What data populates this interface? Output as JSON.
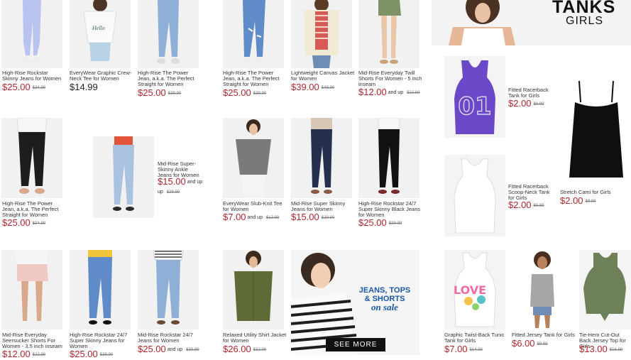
{
  "products": [
    {
      "id": "p1",
      "name": "High-Rise Rockstar Skinny Jeans for Women",
      "price": "$25.00",
      "old": "$34.99",
      "andup": ""
    },
    {
      "id": "p2",
      "name": "EveryWear Graphic Crew-Neck Tee for Women",
      "price": "$14.99",
      "old": "",
      "andup": ""
    },
    {
      "id": "p3",
      "name": "High-Rise The Power Jean, a.k.a. The Perfect Straight for Women",
      "price": "$25.00",
      "old": "$39.99",
      "andup": ""
    },
    {
      "id": "p4",
      "name": "High-Rise The Power Jean, a.k.a. The Perfect Straight for Women",
      "price": "$25.00",
      "old": "$39.99",
      "andup": ""
    },
    {
      "id": "p5",
      "name": "Lightweight Canvas Jacket for Women",
      "price": "$39.00",
      "old": "$49.99",
      "andup": ""
    },
    {
      "id": "p6",
      "name": "Mid-Rise Everyday Twill Shorts For Women - 5 inch inseam",
      "price": "$12.00",
      "old": "$22.99",
      "andup": "and up"
    },
    {
      "id": "p7",
      "name": "High-Rise The Power Jean, a.k.a. The Perfect Straight for Women",
      "price": "$25.00",
      "old": "$34.99",
      "andup": ""
    },
    {
      "id": "p8",
      "name": "Mid-Rise Super-Skinny Ankle Jeans for Women",
      "price": "$15.00",
      "old": "$29.99",
      "andup": "and up"
    },
    {
      "id": "p9",
      "name": "EveryWear Slub-Knit Tee for Women",
      "price": "$7.00",
      "old": "$12.99",
      "andup": "and up"
    },
    {
      "id": "p10",
      "name": "Mid-Rise Super Skinny Jeans for Women",
      "price": "$15.00",
      "old": "$29.99",
      "andup": ""
    },
    {
      "id": "p11",
      "name": "High-Rise Rockstar 24/7 Super Skinny Black Jeans for Women",
      "price": "$25.00",
      "old": "$39.99",
      "andup": ""
    },
    {
      "id": "p12",
      "name": "Mid-Rise Everyday Seersucker Shorts For Women - 3.5 inch inseam",
      "price": "$12.00",
      "old": "$22.99",
      "andup": ""
    },
    {
      "id": "p13",
      "name": "High-Rise Rockstar 24/7 Super Skinny Jeans for Women",
      "price": "$25.00",
      "old": "$39.99",
      "andup": ""
    },
    {
      "id": "p14",
      "name": "Mid-Rise Rockstar 24/7 Jeans for Women",
      "price": "$25.00",
      "old": "$39.99",
      "andup": "and up"
    },
    {
      "id": "p15",
      "name": "Relaxed Utility Shirt Jacket for Women",
      "price": "$26.00",
      "old": "$32.99",
      "andup": ""
    },
    {
      "id": "g1",
      "name": "Fitted Racerback Tank for Girls",
      "price": "$2.00",
      "old": "$9.99",
      "andup": ""
    },
    {
      "id": "g2",
      "name": "Fitted Racerback Scoop-Neck Tank for Girls",
      "price": "$2.00",
      "old": "$9.99",
      "andup": ""
    },
    {
      "id": "g3",
      "name": "Stretch Cami for Girls",
      "price": "$2.00",
      "old": "$9.99",
      "andup": ""
    },
    {
      "id": "g4",
      "name": "Graphic Twist-Back Tunic Tank for Girls",
      "price": "$7.00",
      "old": "$14.99",
      "andup": ""
    },
    {
      "id": "g5",
      "name": "Fitted Jersey Tank for Girls",
      "price": "$6.00",
      "old": "$9.99",
      "andup": ""
    },
    {
      "id": "g6",
      "name": "Tie-Hem Cut-Out Back Jersey Top for Girls",
      "price": "$13.00",
      "old": "$16.99",
      "andup": ""
    }
  ],
  "banner": {
    "title": "TANKS",
    "subtitle": "GIRLS"
  },
  "promo": {
    "line1": "JEANS, TOPS",
    "line2": "& SHORTS",
    "line3": "on sale",
    "button": "SEE MORE"
  },
  "tank_graphic": {
    "number": "01",
    "love": "LOVE"
  },
  "colors": {
    "sale_red": "#b3242b",
    "promo_blue": "#1a57a6",
    "tank_purple": "#6b48c8",
    "tank_green": "#6e8057"
  }
}
